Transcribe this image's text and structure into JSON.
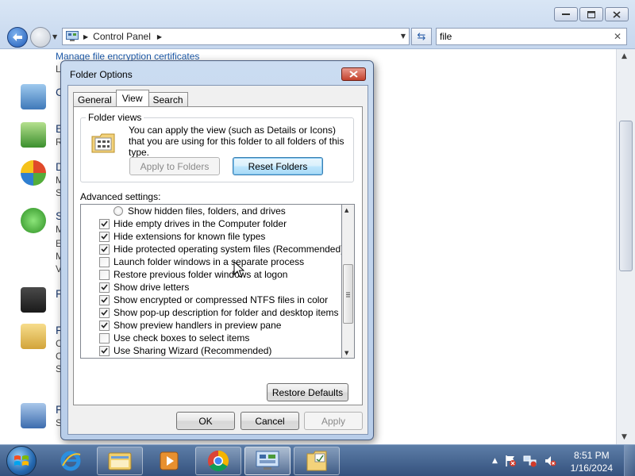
{
  "explorer": {
    "address_crumb": "Control Panel",
    "search_value": "file",
    "bg_link": "Manage file encryption certificates",
    "bg_letters": [
      "L",
      "C",
      "E",
      "R",
      "D",
      "M",
      "S",
      "S",
      "M",
      "E",
      "M",
      "V",
      "F",
      "F",
      "C",
      "C",
      "S",
      "F",
      "S"
    ]
  },
  "dialog": {
    "title": "Folder Options",
    "tabs": [
      "General",
      "View",
      "Search"
    ],
    "active_tab": "View",
    "folder_views": {
      "legend": "Folder views",
      "description": "You can apply the view (such as Details or Icons) that you are using for this folder to all folders of this type.",
      "apply_button": "Apply to Folders",
      "reset_button": "Reset Folders"
    },
    "advanced_label": "Advanced settings:",
    "advanced_items": [
      {
        "label": "Show hidden files, folders, and drives",
        "type": "radio",
        "checked": false
      },
      {
        "label": "Hide empty drives in the Computer folder",
        "type": "check",
        "checked": true
      },
      {
        "label": "Hide extensions for known file types",
        "type": "check",
        "checked": true
      },
      {
        "label": "Hide protected operating system files (Recommended)",
        "type": "check",
        "checked": true
      },
      {
        "label": "Launch folder windows in a separate process",
        "type": "check",
        "checked": false
      },
      {
        "label": "Restore previous folder windows at logon",
        "type": "check",
        "checked": false
      },
      {
        "label": "Show drive letters",
        "type": "check",
        "checked": true
      },
      {
        "label": "Show encrypted or compressed NTFS files in color",
        "type": "check",
        "checked": true
      },
      {
        "label": "Show pop-up description for folder and desktop items",
        "type": "check",
        "checked": true
      },
      {
        "label": "Show preview handlers in preview pane",
        "type": "check",
        "checked": true
      },
      {
        "label": "Use check boxes to select items",
        "type": "check",
        "checked": false
      },
      {
        "label": "Use Sharing Wizard (Recommended)",
        "type": "check",
        "checked": true
      }
    ],
    "restore_defaults": "Restore Defaults",
    "ok": "OK",
    "cancel": "Cancel",
    "apply": "Apply"
  },
  "taskbar": {
    "time": "8:51 PM",
    "date": "1/16/2024",
    "items": [
      "ie-icon",
      "file-explorer-icon",
      "media-player-icon",
      "chrome-icon",
      "control-panel-icon",
      "folder-options-icon"
    ]
  },
  "colors": {
    "accent": "#3c7fb1",
    "link": "#1e5aa8",
    "taskbar": "#34517d",
    "close": "#c3412c"
  }
}
